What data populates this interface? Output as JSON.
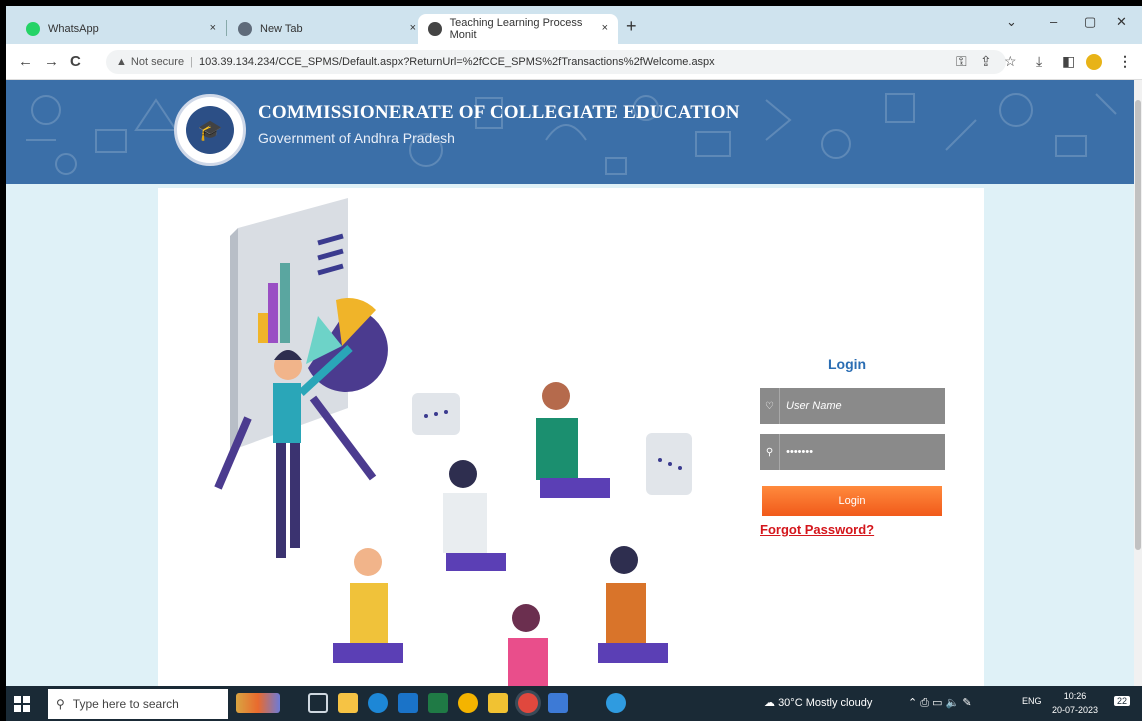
{
  "browser": {
    "tabs": [
      {
        "title": "WhatsApp",
        "close": "×"
      },
      {
        "title": "New Tab",
        "close": "×"
      },
      {
        "title": "Teaching Learning Process Monit",
        "close": "×"
      }
    ],
    "new_tab": "+",
    "window_controls": {
      "dropdown": "⌄",
      "minimize": "–",
      "maximize": "▢",
      "close": "✕"
    },
    "nav": {
      "back": "←",
      "forward": "→",
      "reload": "C"
    },
    "address": {
      "warning_icon": "▲",
      "security": "Not secure",
      "url": "103.39.134.234/CCE_SPMS/Default.aspx?ReturnUrl=%2fCCE_SPMS%2fTransactions%2fWelcome.aspx"
    }
  },
  "site": {
    "title": "COMMISSIONERATE OF COLLEGIATE EDUCATION",
    "subtitle": "Government of Andhra Pradesh",
    "header_color": "#3b6fa8"
  },
  "login": {
    "title": "Login",
    "username_placeholder": "User Name",
    "password_value": "•••••••",
    "button": "Login",
    "forgot": "Forgot Password?",
    "button_color": "#f26b2a",
    "link_color": "#d4161c"
  },
  "taskbar": {
    "search_placeholder": "Type here to search",
    "weather": "30°C  Mostly cloudy",
    "lang": "ENG",
    "time": "10:26",
    "date": "20-07-2023",
    "notifications": "22"
  }
}
